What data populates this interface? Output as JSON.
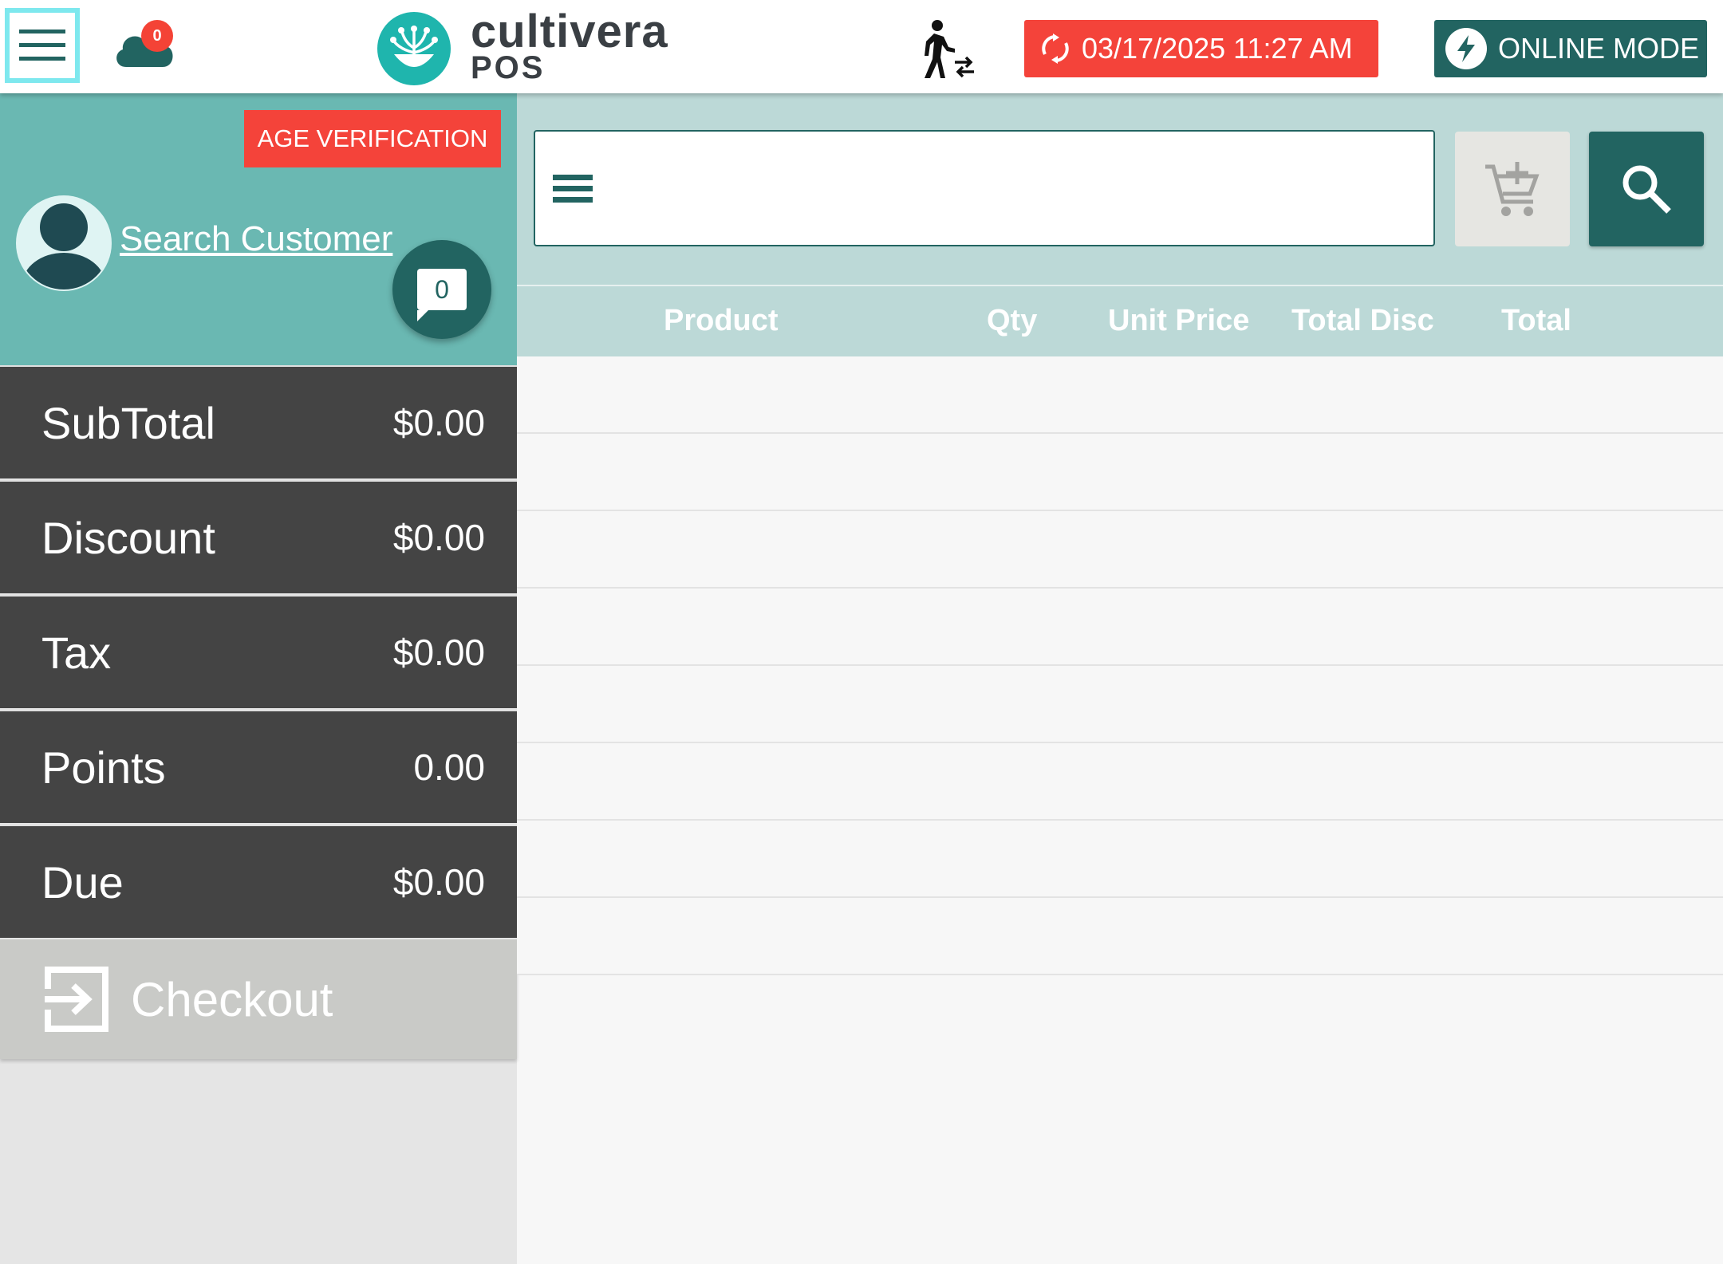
{
  "header": {
    "menu_icon": "hamburger-menu-icon",
    "cloud_icon": "cloud-sync-icon",
    "cloud_badge": "0",
    "logo": {
      "name": "cultivera",
      "sub": "POS",
      "accent_color": "#1fb5ad"
    },
    "user_switch_icon": "walking-person-swap-icon",
    "datetime": "03/17/2025 11:27 AM",
    "sync_icon": "sync-icon",
    "mode_label": "ONLINE MODE",
    "mode_icon": "lightning-bolt-icon"
  },
  "customer": {
    "age_verification_label": "AGE VERIFICATION",
    "avatar_icon": "user-avatar-icon",
    "search_label": "Search Customer",
    "notes_count": "0"
  },
  "summary": {
    "subtotal_label": "SubTotal",
    "subtotal_value": "$0.00",
    "discount_label": "Discount",
    "discount_value": "$0.00",
    "tax_label": "Tax",
    "tax_value": "$0.00",
    "points_label": "Points",
    "points_value": "0.00",
    "due_label": "Due",
    "due_value": "$0.00"
  },
  "checkout": {
    "label": "Checkout",
    "icon": "exit-to-app-icon"
  },
  "search": {
    "placeholder": "",
    "menu_icon": "list-lines-icon",
    "add_cart_icon": "add-to-cart-icon",
    "search_icon": "search-icon"
  },
  "table": {
    "columns": [
      "Product",
      "Qty",
      "Unit Price",
      "Total Disc",
      "Total"
    ]
  },
  "colors": {
    "primary": "#226461",
    "alert": "#f4433a",
    "teal_panel": "#6ab8b2",
    "light_teal": "#bcd9d7",
    "summary_bg": "#444444"
  }
}
